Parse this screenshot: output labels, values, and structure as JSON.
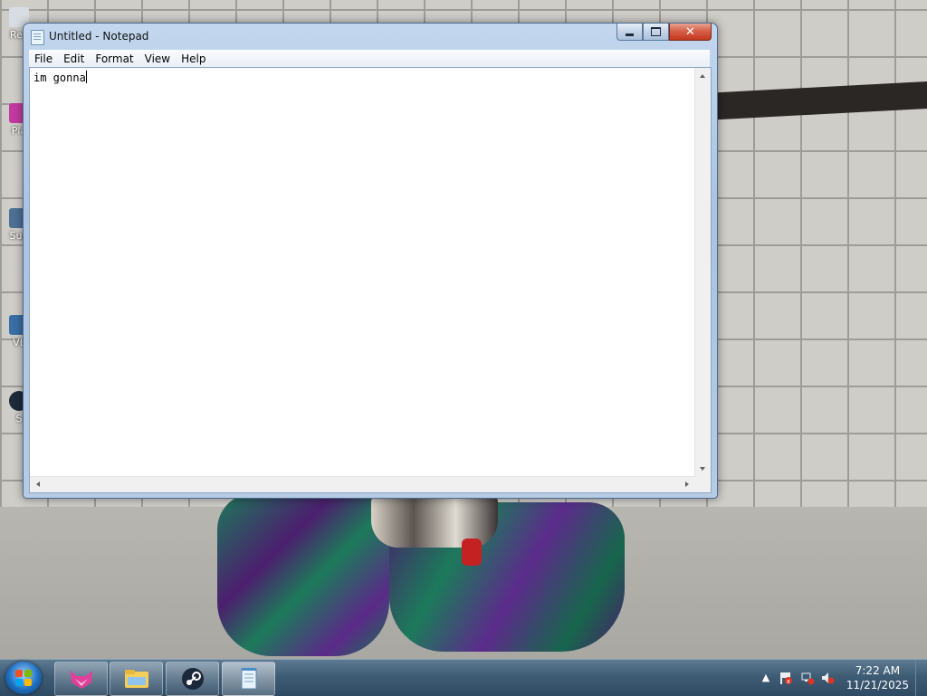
{
  "window": {
    "title": "Untitled - Notepad",
    "controls": {
      "minimize": "",
      "maximize": "",
      "close": "✕"
    }
  },
  "menu": [
    "File",
    "Edit",
    "Format",
    "View",
    "Help"
  ],
  "editor": {
    "content": "im gonna"
  },
  "desktop_icons": [
    {
      "label": "Rec"
    },
    {
      "label": "Pla"
    },
    {
      "label": "Sup"
    },
    {
      "label": "VL"
    },
    {
      "label": "S"
    }
  ],
  "taskbar": {
    "pinned": [
      "start-button",
      "app-fox-icon",
      "file-explorer-icon",
      "steam-icon",
      "notepad-icon"
    ],
    "tray": {
      "time": "7:22 AM",
      "date": "11/21/2025",
      "expand": "▲"
    }
  },
  "colors": {
    "window_frame": "#a9c3e1",
    "close_button": "#d8614a",
    "taskbar": "#3f5c75"
  }
}
